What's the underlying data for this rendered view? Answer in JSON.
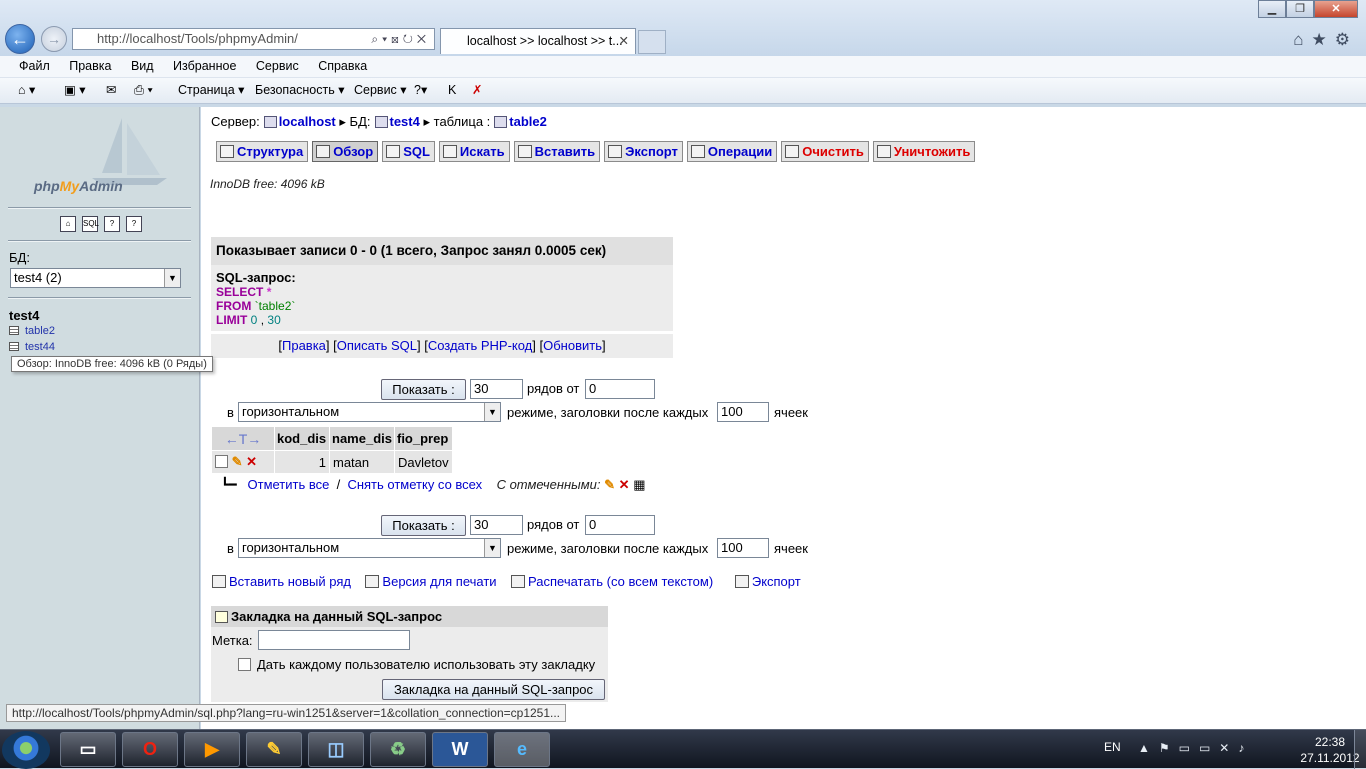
{
  "browser": {
    "address": "http://localhost/Tools/phpmyAdmin/",
    "tab_title": "localhost >> localhost >> t...",
    "window_controls": [
      "minimize-icon",
      "restore-icon",
      "close-icon"
    ]
  },
  "menu": [
    "Файл",
    "Правка",
    "Вид",
    "Избранное",
    "Сервис",
    "Справка"
  ],
  "command_bar": {
    "page": "Страница",
    "safety": "Безопасность",
    "tools": "Сервис"
  },
  "sidebar": {
    "logo_php": "php",
    "logo_my": "My",
    "logo_admin": "Admin",
    "db_label": "БД:",
    "db_select": "test4 (2)",
    "db_name": "test4",
    "tables": [
      "table2",
      "test44"
    ],
    "tooltip": "Обзор: InnoDB free: 4096 kB (0 Ряды)"
  },
  "breadcrumb": {
    "server_label": "Сервер:",
    "server": "localhost",
    "db_label": "БД:",
    "db": "test4",
    "table_label": "таблица :",
    "table": "table2"
  },
  "tabs": [
    "Структура",
    "Обзор",
    "SQL",
    "Искать",
    "Вставить",
    "Экспорт",
    "Операции",
    "Очистить",
    "Уничтожить"
  ],
  "innodb_free": "InnoDB free: 4096 kB",
  "result": {
    "header": "Показывает записи 0 - 0 (1 всего, Запрос занял 0.0005 сек)",
    "sql_label": "SQL-запрос:",
    "select": "SELECT",
    "star": "*",
    "from": "FROM",
    "table": "`table2`",
    "limit": "LIMIT",
    "limit_a": "0",
    "limit_sep": ",",
    "limit_b": "30",
    "links": [
      "Правка",
      "Описать SQL",
      "Создать PHP-код",
      "Обновить"
    ]
  },
  "nav": {
    "show_button": "Показать :",
    "rows": "30",
    "rows_from": "рядов от",
    "start": "0",
    "in": "в",
    "mode": "горизонтальном",
    "mode_text": "режиме, заголовки после каждых",
    "repeat": "100",
    "cells": "ячеек"
  },
  "grid": {
    "arrows": "←T→",
    "columns": [
      "kod_dis",
      "name_dis",
      "fio_prep"
    ],
    "rows": [
      [
        "1",
        "matan",
        "Davletov"
      ]
    ]
  },
  "marking": {
    "check_all": "Отметить все",
    "sep": "/",
    "uncheck_all": "Снять отметку со всех",
    "with_selected": "С отмеченными:"
  },
  "bottom_links": [
    "Вставить новый ряд",
    "Версия для печати",
    "Распечатать (со всем текстом)",
    "Экспорт"
  ],
  "bookmark": {
    "header": "Закладка на данный SQL-запрос",
    "label": "Метка:",
    "share": "Дать каждому пользователю использовать эту закладку",
    "button": "Закладка на данный SQL-запрос"
  },
  "status_url": "http://localhost/Tools/phpmyAdmin/sql.php?lang=ru-win1251&server=1&collation_connection=cp1251...",
  "taskbar": {
    "lang": "EN",
    "time": "22:38",
    "date": "27.11.2012"
  }
}
